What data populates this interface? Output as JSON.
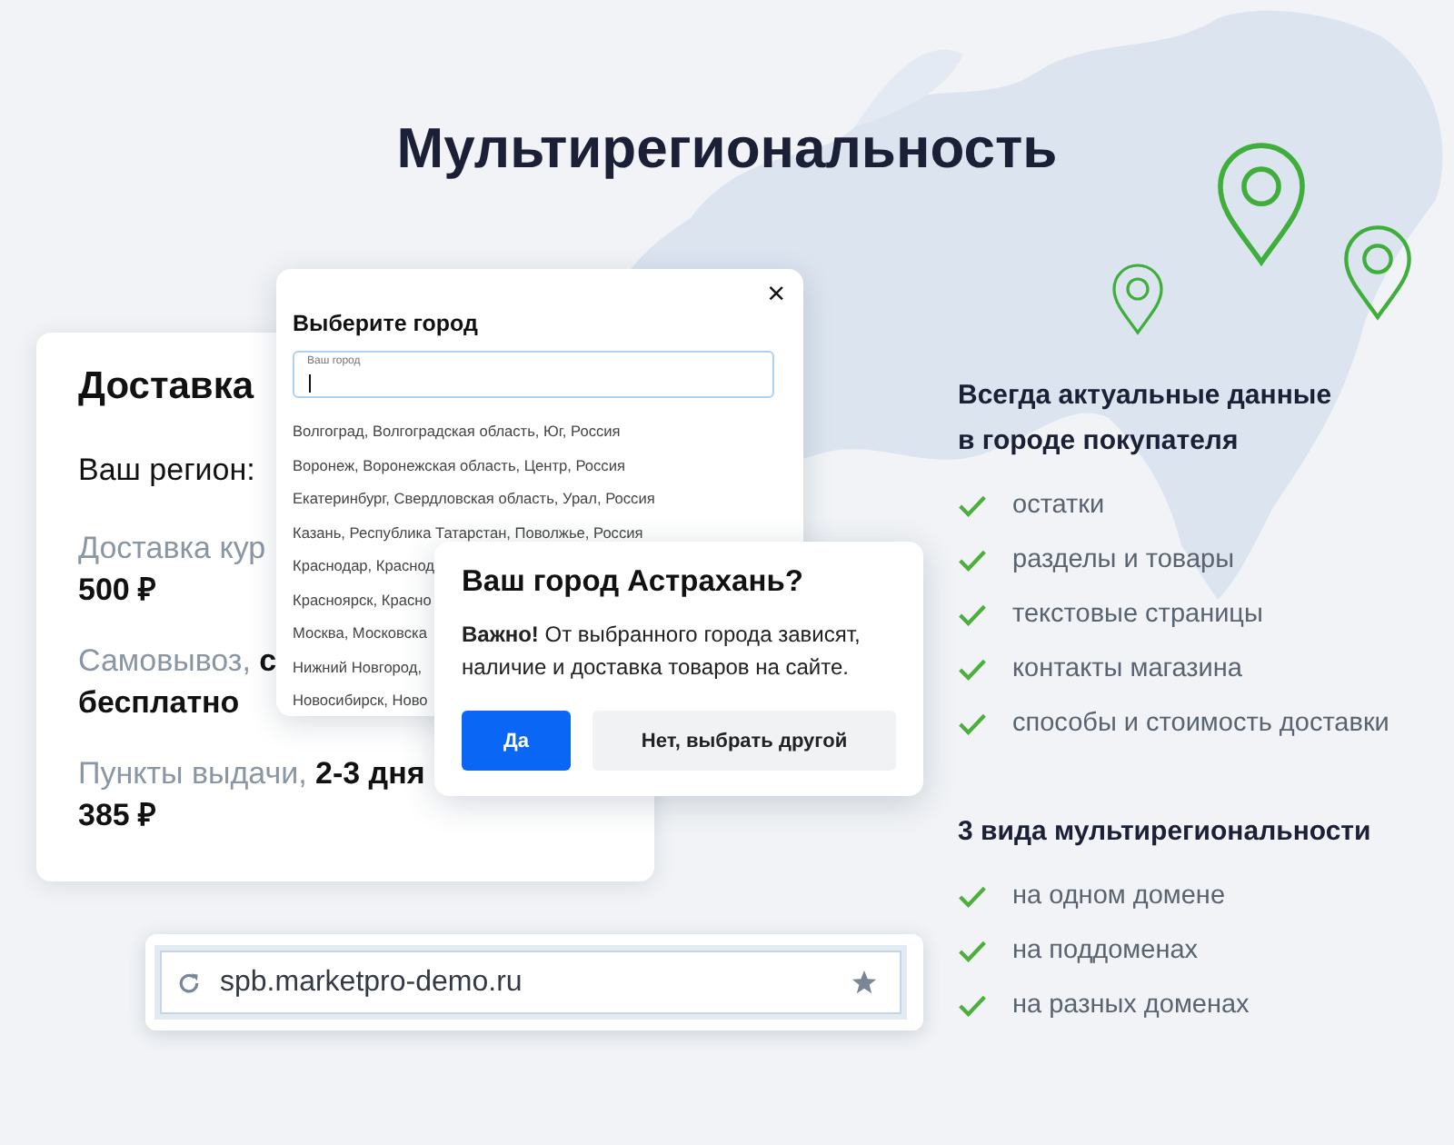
{
  "page_title": "Мультирегиональность",
  "delivery_card": {
    "title": "Доставка",
    "region_label": "Ваш регион:",
    "rows": [
      {
        "label": "Доставка кур",
        "value": "500 ₽"
      },
      {
        "label": "Самовывоз, **с**",
        "value": "бесплатно"
      },
      {
        "label": "Пункты выдачи, **2-3 дня**",
        "value": "385 ₽"
      }
    ]
  },
  "city_popup": {
    "title": "Выберите город",
    "close": "×",
    "field": {
      "label": "Ваш город",
      "focused": true
    },
    "cities": [
      "Волгоград, Волгоградская область, Юг, Россия",
      "Воронеж, Воронежская область, Центр, Россия",
      "Екатеринбург, Свердловская область, Урал, Россия",
      "Казань, Республика Татарстан, Поволжье, Россия",
      "Краснодар, Краснод",
      "Красноярск, Красно",
      "Москва, Московска",
      "Нижний Новгород,",
      "Новосибирск, Ново"
    ]
  },
  "confirm_popup": {
    "title": "Ваш город Астрахань?",
    "text": "**Важно!** От выбранного города зависят, наличие и доставка товаров на сайте.",
    "buttons": [
      {
        "label": "Да",
        "kind": "primary"
      },
      {
        "label": "Нет, выбрать другой",
        "kind": "secondary"
      }
    ]
  },
  "address_bar": {
    "url": "spb.marketpro-demo.ru"
  },
  "features": [
    {
      "title": "Всегда актуальные данные в городе покупателя",
      "items": [
        "остатки",
        "разделы и товары",
        "текстовые страницы",
        "контакты магазина",
        "способы и стоимость доставки"
      ]
    },
    {
      "title": "3 вида мультирегиональности",
      "items": [
        "на одном домене",
        "на поддоменах",
        "на разных доменах"
      ]
    }
  ]
}
